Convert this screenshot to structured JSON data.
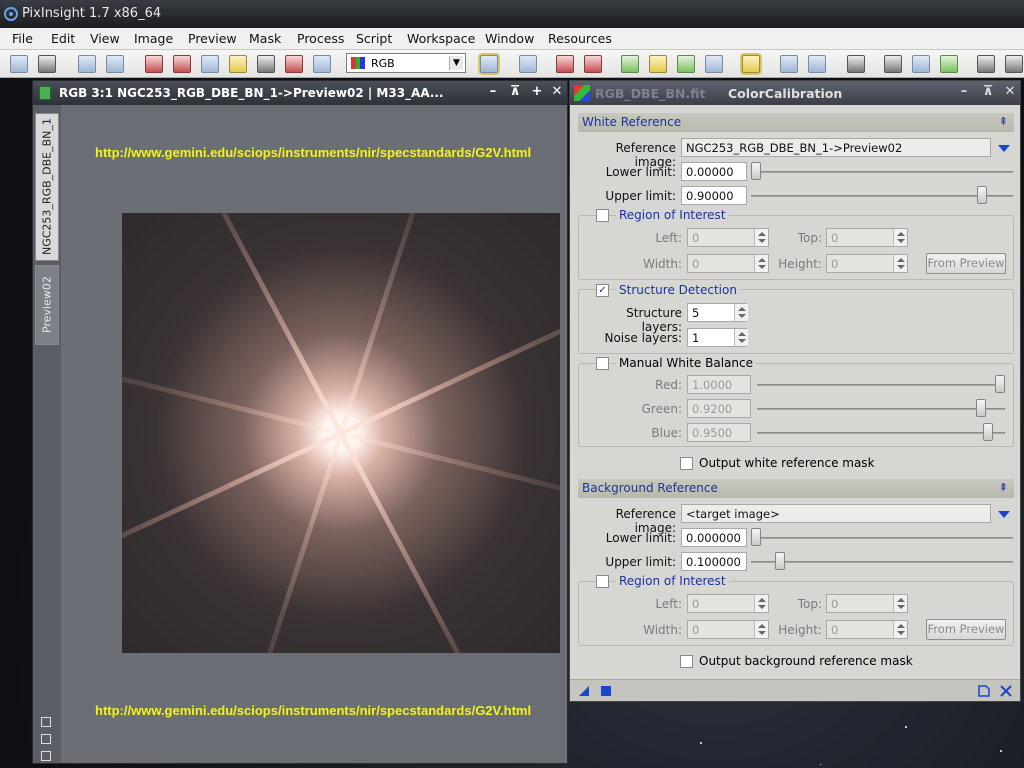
{
  "window": {
    "title": "PixInsight 1.7 x86_64"
  },
  "menu": [
    "File",
    "Edit",
    "View",
    "Image",
    "Preview",
    "Mask",
    "Process",
    "Script",
    "Workspace",
    "Window",
    "Resources"
  ],
  "toolbar": {
    "color_mode": "RGB"
  },
  "image_window": {
    "title": "RGB 3:1 NGC253_RGB_DBE_BN_1->Preview02 | M33_AA...",
    "tabs": [
      "NGC253_RGB_DBE_BN_1",
      "Preview02"
    ],
    "url_top": "http://www.gemini.edu/sciops/instruments/nir/specstandards/G2V.html",
    "url_bottom": "http://www.gemini.edu/sciops/instruments/nir/specstandards/G2V.html"
  },
  "process": {
    "ghost_title": "RGB_DBE_BN.fit",
    "title": "ColorCalibration",
    "white_reference": {
      "header": "White Reference",
      "reference_image_label": "Reference image:",
      "reference_image": "NGC253_RGB_DBE_BN_1->Preview02",
      "lower_limit_label": "Lower limit:",
      "lower_limit": "0.00000",
      "lower_limit_fraction": 0.0,
      "upper_limit_label": "Upper limit:",
      "upper_limit": "0.90000",
      "upper_limit_fraction": 0.9,
      "roi": {
        "label": "Region of Interest",
        "left_label": "Left:",
        "left": "0",
        "top_label": "Top:",
        "top": "0",
        "width_label": "Width:",
        "width": "0",
        "height_label": "Height:",
        "height": "0",
        "from_preview": "From Preview"
      },
      "structure_detection": {
        "label": "Structure Detection",
        "checked": true,
        "layers_label": "Structure layers:",
        "layers": "5",
        "noise_label": "Noise layers:",
        "noise": "1"
      },
      "manual_wb": {
        "label": "Manual White Balance",
        "red_label": "Red:",
        "red": "1.0000",
        "red_fraction": 1.0,
        "green_label": "Green:",
        "green": "0.9200",
        "green_fraction": 0.92,
        "blue_label": "Blue:",
        "blue": "0.9500",
        "blue_fraction": 0.95
      },
      "output_mask_label": "Output white reference mask"
    },
    "background_reference": {
      "header": "Background Reference",
      "reference_image_label": "Reference image:",
      "reference_image": "<target image>",
      "lower_limit_label": "Lower limit:",
      "lower_limit": "0.000000",
      "lower_limit_fraction": 0.0,
      "upper_limit_label": "Upper limit:",
      "upper_limit": "0.100000",
      "upper_limit_fraction": 0.1,
      "roi": {
        "label": "Region of Interest",
        "left_label": "Left:",
        "left": "0",
        "top_label": "Top:",
        "top": "0",
        "width_label": "Width:",
        "width": "0",
        "height_label": "Height:",
        "height": "0",
        "from_preview": "From Preview"
      },
      "output_mask_label": "Output background reference mask"
    }
  }
}
